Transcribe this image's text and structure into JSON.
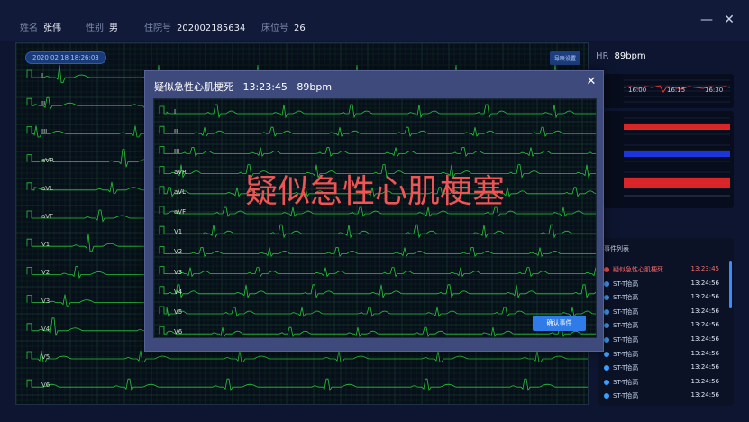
{
  "patient": {
    "name_label": "姓名",
    "name": "张伟",
    "gender_label": "性别",
    "gender": "男",
    "admission_label": "住院号",
    "admission_no": "202002185634",
    "bed_label": "床位号",
    "bed_no": "26"
  },
  "window_controls": {
    "minimize": "—",
    "close": "✕"
  },
  "ecg_main": {
    "datetime": "2020 02 18  18:26:03",
    "speed_button": "导联设置",
    "leads": [
      "I",
      "II",
      "III",
      "aVR",
      "aVL",
      "aVF",
      "V1",
      "V2",
      "V3",
      "V4",
      "V5",
      "V6"
    ]
  },
  "vitals": {
    "hr_label": "HR",
    "hr_value": "89bpm"
  },
  "trend": {
    "time_ticks": [
      "16:00",
      "16:15",
      "16:30"
    ]
  },
  "events": {
    "title": "事件列表",
    "items": [
      {
        "name": "疑似急性心肌梗死",
        "time": "13:23:45",
        "alert": true
      },
      {
        "name": "ST-T抬高",
        "time": "13:24:56",
        "alert": false
      },
      {
        "name": "ST-T抬高",
        "time": "13:24:56",
        "alert": false
      },
      {
        "name": "ST-T抬高",
        "time": "13:24:56",
        "alert": false
      },
      {
        "name": "ST-T抬高",
        "time": "13:24:56",
        "alert": false
      },
      {
        "name": "ST-T抬高",
        "time": "13:24:56",
        "alert": false
      },
      {
        "name": "ST-T抬高",
        "time": "13:24:56",
        "alert": false
      },
      {
        "name": "ST-T抬高",
        "time": "13:24:56",
        "alert": false
      },
      {
        "name": "ST-T抬高",
        "time": "13:24:56",
        "alert": false
      },
      {
        "name": "ST-T抬高",
        "time": "13:24:56",
        "alert": false
      },
      {
        "name": "ST-T抬高",
        "time": "13:24:56",
        "alert": false
      }
    ]
  },
  "modal": {
    "title": "疑似急性心肌梗死",
    "time": "13:23:45",
    "hr": "89bpm",
    "warning": "疑似急性心肌梗塞",
    "confirm_button": "确认事件",
    "close": "✕",
    "leads": [
      "I",
      "II",
      "III",
      "aVR",
      "aVL",
      "aVF",
      "V1",
      "V2",
      "V3",
      "V4",
      "V5",
      "V6"
    ]
  },
  "colors": {
    "ecg_trace": "#27c43a",
    "grid": "#1c3a2c",
    "alert": "#f05454",
    "accent": "#2f7be8"
  }
}
